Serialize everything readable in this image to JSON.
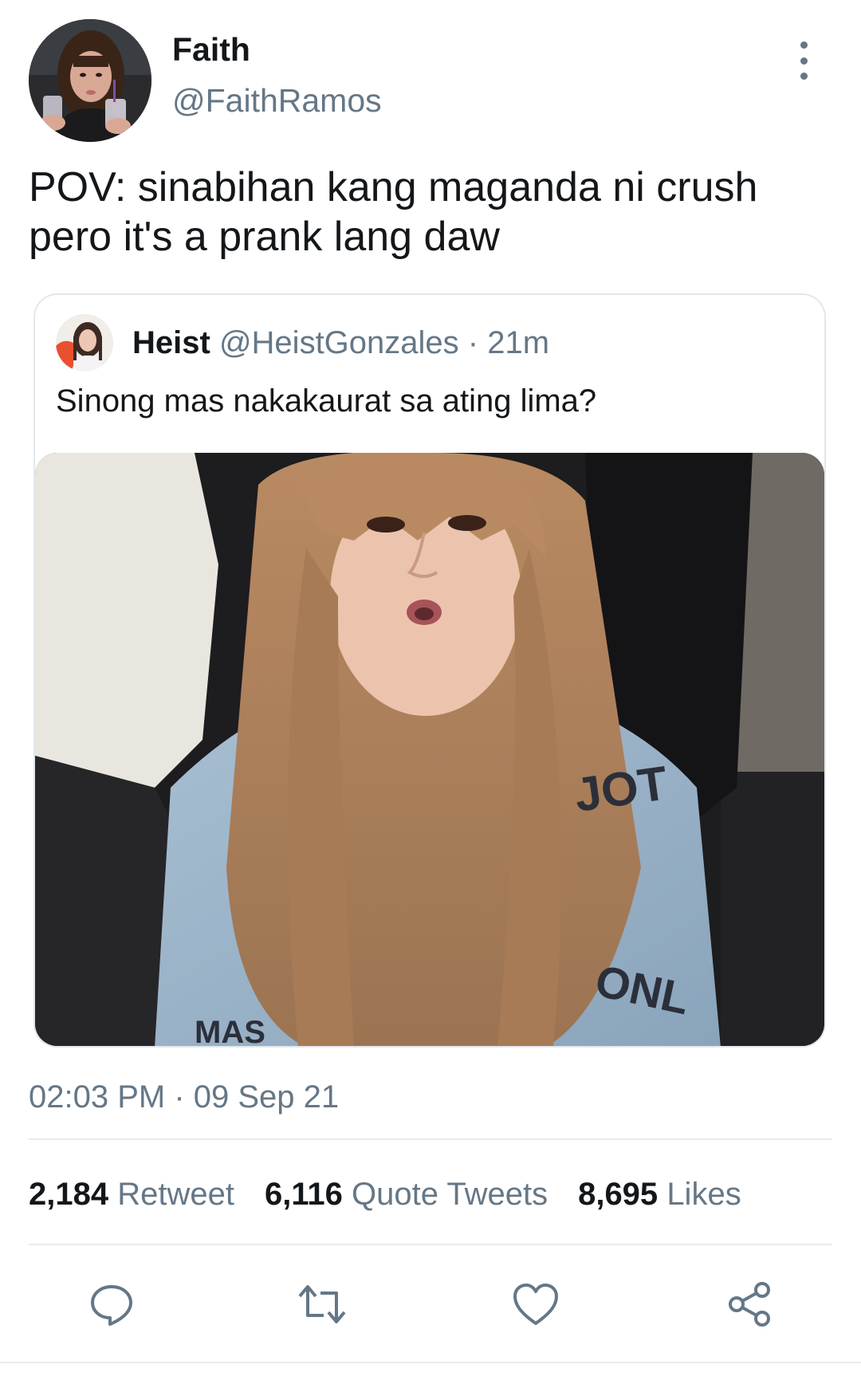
{
  "tweet": {
    "author": {
      "display_name": "Faith",
      "handle": "@FaithRamos",
      "avatar_icon": "profile-photo"
    },
    "text": "POV: sinabihan kang maganda ni crush pero it's a prank lang daw",
    "quote": {
      "display_name": "Heist",
      "handle": "@HeistGonzales",
      "separator": "·",
      "time": "21m",
      "text": "Sinong mas nakakaurat sa ating lima?",
      "media": "photo"
    },
    "timestamp": "02:03 PM · 09 Sep 21",
    "stats": {
      "retweets": {
        "count": "2,184",
        "label": "Retweet"
      },
      "quotes": {
        "count": "6,116",
        "label": "Quote Tweets"
      },
      "likes": {
        "count": "8,695",
        "label": "Likes"
      }
    },
    "actions": {
      "reply_icon": "reply-icon",
      "retweet_icon": "retweet-icon",
      "like_icon": "heart-icon",
      "share_icon": "share-icon"
    }
  },
  "colors": {
    "text_primary": "#14171a",
    "text_secondary": "#657786",
    "border": "#e1e8ed"
  }
}
